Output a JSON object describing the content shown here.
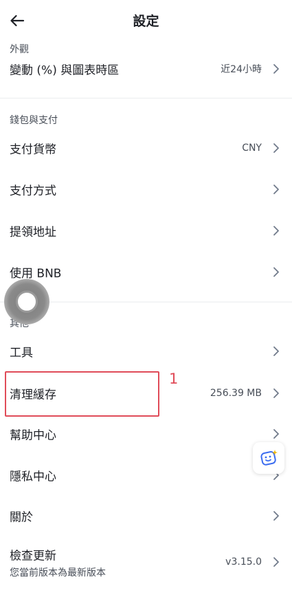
{
  "header": {
    "title": "設定",
    "back_icon": "arrow-left-icon"
  },
  "appearance": {
    "section_title": "外觀",
    "change_timezone": {
      "label": "變動 (%) 與圖表時區",
      "value": "近24小時"
    }
  },
  "wallet": {
    "section_title": "錢包與支付",
    "currency": {
      "label": "支付貨幣",
      "value": "CNY"
    },
    "payment_method": {
      "label": "支付方式"
    },
    "withdraw_address": {
      "label": "提領地址"
    },
    "use_bnb": {
      "label": "使用 BNB"
    }
  },
  "other": {
    "section_title": "其他",
    "tools": {
      "label": "工具"
    },
    "clear_cache": {
      "label": "清理緩存",
      "value": "256.39 MB"
    },
    "help": {
      "label": "幫助中心"
    },
    "privacy": {
      "label": "隱私中心"
    },
    "about": {
      "label": "關於"
    },
    "update": {
      "label": "檢查更新",
      "sub": "您當前版本為最新版本",
      "value": "v3.15.0"
    }
  },
  "annotation": {
    "number": "1",
    "color": "#e04b58"
  },
  "colors": {
    "text": "#1e2026",
    "secondary": "#474d57",
    "divider": "#eaecef",
    "chevron": "#707a8a"
  }
}
